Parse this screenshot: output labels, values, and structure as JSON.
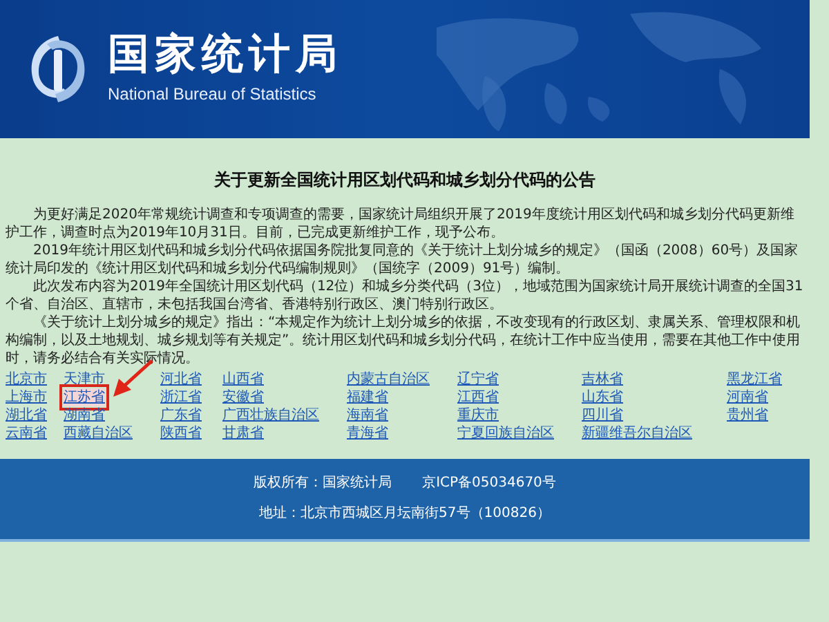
{
  "header": {
    "title": "国家统计局",
    "subtitle": "National Bureau of Statistics"
  },
  "notice": {
    "title": "关于更新全国统计用区划代码和城乡划分代码的公告",
    "paragraphs": [
      "为更好满足2020年常规统计调查和专项调查的需要，国家统计局组织开展了2019年度统计用区划代码和城乡划分代码更新维护工作，调查时点为2019年10月31日。目前，已完成更新维护工作，现予公布。",
      "2019年统计用区划代码和城乡划分代码依据国务院批复同意的《关于统计上划分城乡的规定》（国函（2008）60号）及国家统计局印发的《统计用区划代码和城乡划分代码编制规则》（国统字（2009）91号）编制。",
      "此次发布内容为2019年全国统计用区划代码（12位）和城乡分类代码（3位），地域范围为国家统计局开展统计调查的全国31个省、自治区、直辖市，未包括我国台湾省、香港特别行政区、澳门特别行政区。",
      "《关于统计上划分城乡的规定》指出：“本规定作为统计上划分城乡的依据，不改变现有的行政区划、隶属关系、管理权限和机构编制，以及土地规划、城乡规划等有关规定”。统计用区划代码和城乡划分代码，在统计工作中应当使用，需要在其他工作中使用时，请务必结合有关实际情况。"
    ]
  },
  "provinces": [
    {
      "name": "北京市",
      "highlighted": false
    },
    {
      "name": "天津市",
      "highlighted": false
    },
    {
      "name": "河北省",
      "highlighted": false
    },
    {
      "name": "山西省",
      "highlighted": false
    },
    {
      "name": "内蒙古自治区",
      "highlighted": false
    },
    {
      "name": "辽宁省",
      "highlighted": false
    },
    {
      "name": "吉林省",
      "highlighted": false
    },
    {
      "name": "黑龙江省",
      "highlighted": false
    },
    {
      "name": "上海市",
      "highlighted": false
    },
    {
      "name": "江苏省",
      "highlighted": true
    },
    {
      "name": "浙江省",
      "highlighted": false
    },
    {
      "name": "安徽省",
      "highlighted": false
    },
    {
      "name": "福建省",
      "highlighted": false
    },
    {
      "name": "江西省",
      "highlighted": false
    },
    {
      "name": "山东省",
      "highlighted": false
    },
    {
      "name": "河南省",
      "highlighted": false
    },
    {
      "name": "湖北省",
      "highlighted": false
    },
    {
      "name": "湖南省",
      "highlighted": false
    },
    {
      "name": "广东省",
      "highlighted": false
    },
    {
      "name": "广西壮族自治区",
      "highlighted": false
    },
    {
      "name": "海南省",
      "highlighted": false
    },
    {
      "name": "重庆市",
      "highlighted": false
    },
    {
      "name": "四川省",
      "highlighted": false
    },
    {
      "name": "贵州省",
      "highlighted": false
    },
    {
      "name": "云南省",
      "highlighted": false
    },
    {
      "name": "西藏自治区",
      "highlighted": false
    },
    {
      "name": "陕西省",
      "highlighted": false
    },
    {
      "name": "甘肃省",
      "highlighted": false
    },
    {
      "name": "青海省",
      "highlighted": false
    },
    {
      "name": "宁夏回族自治区",
      "highlighted": false
    },
    {
      "name": "新疆维吾尔自治区",
      "highlighted": false
    }
  ],
  "footer": {
    "copyright": "版权所有：国家统计局",
    "icp": "京ICP备05034670号",
    "address": "地址：北京市西城区月坛南街57号（100826）"
  }
}
